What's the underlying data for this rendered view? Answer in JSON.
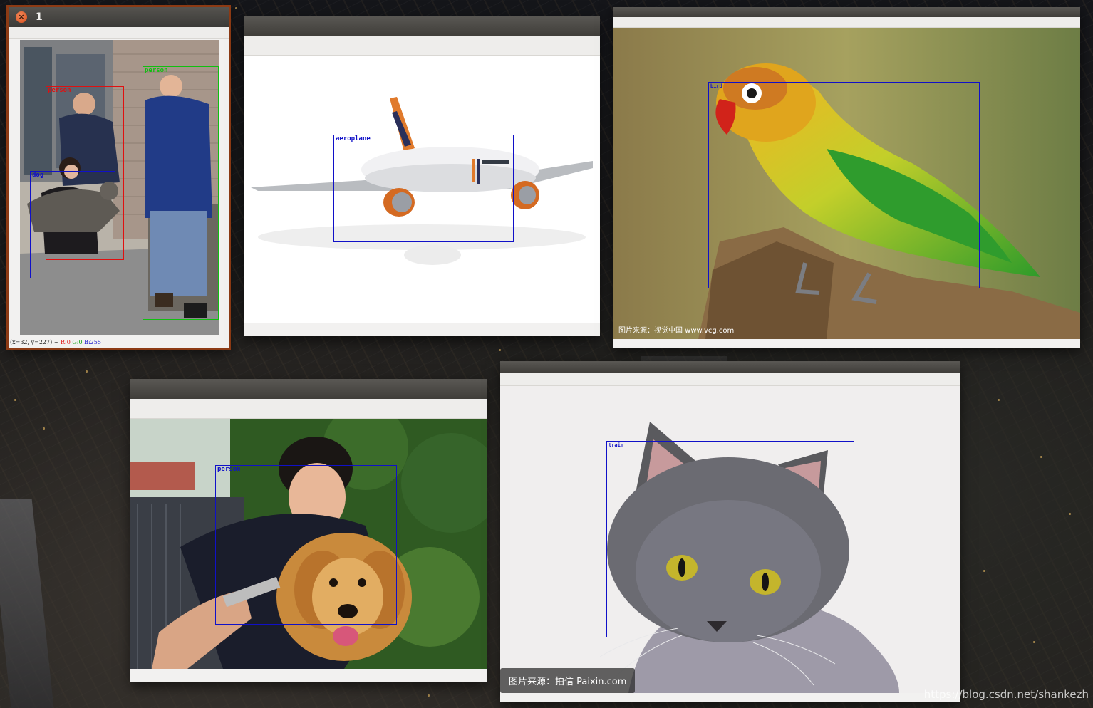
{
  "window1": {
    "title": "1",
    "close_glyph": "×",
    "detections": [
      "person",
      "person",
      "dog"
    ],
    "status": {
      "coords": "(x=32, y=227) ~",
      "r": "R:0",
      "g": "G:0",
      "b": "B:255"
    }
  },
  "window2": {
    "detections": [
      "aeroplane"
    ]
  },
  "window3": {
    "detections": [
      "bird"
    ],
    "image_credit": "图片来源：视觉中国 www.vcg.com"
  },
  "window4": {
    "detections": [
      "person"
    ]
  },
  "window5": {
    "detections": [
      "train"
    ],
    "image_credit": "图片来源：拍信 Paixin.com"
  },
  "desktop": {
    "watermark": "https://blog.csdn.net/shankezh"
  },
  "colors": {
    "box_red": "#e01010",
    "box_green": "#10c010",
    "box_blue": "#1010c8",
    "close_button": "#e0602a",
    "titlebar": "#45433f"
  },
  "icons": {
    "close": "close-icon"
  }
}
